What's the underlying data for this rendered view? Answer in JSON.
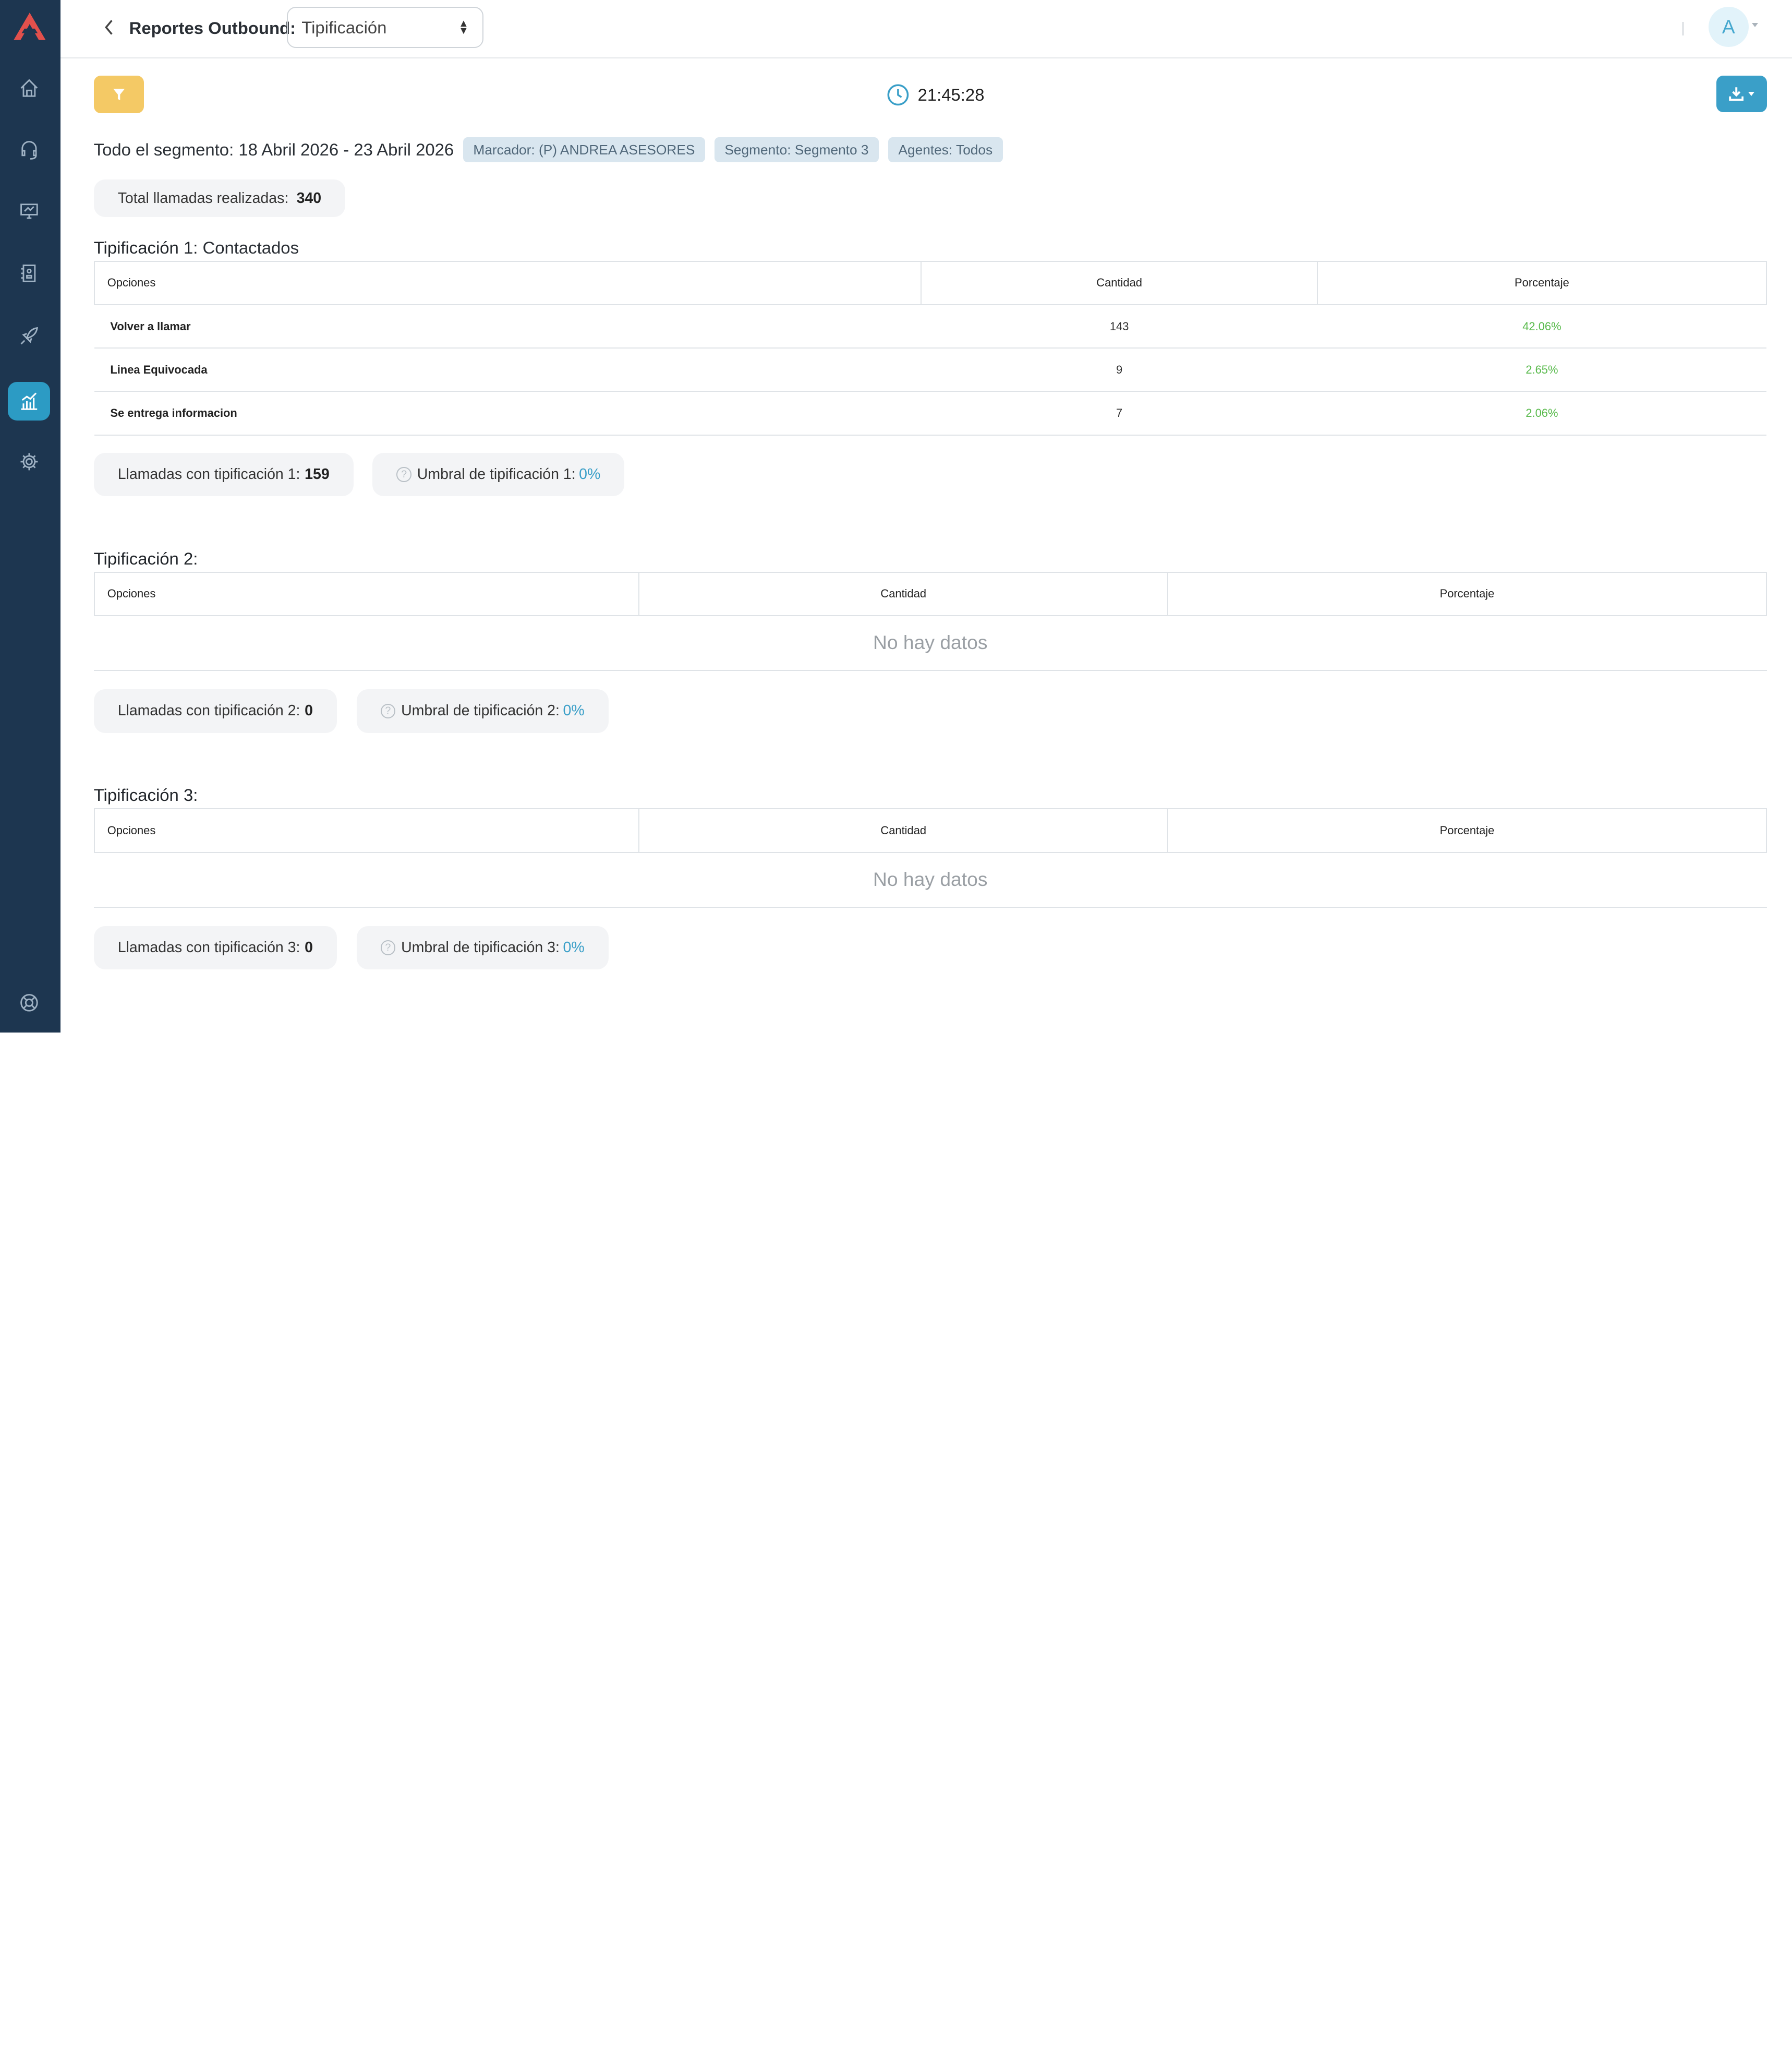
{
  "header": {
    "title": "Reportes Outbound:",
    "report_select": "Tipificación",
    "avatar_initial": "A"
  },
  "toolbar": {
    "clock_time": "21:45:28"
  },
  "segment": {
    "summary": "Todo el segmento: 18 Abril 2026 - 23 Abril 2026",
    "chips": [
      "Marcador: (P) ANDREA ASESORES",
      "Segmento: Segmento 3",
      "Agentes: Todos"
    ]
  },
  "totals": {
    "label": "Total llamadas realizadas:",
    "value": "340"
  },
  "sections": [
    {
      "title_lead": "Tipificación 1:",
      "title_value": "Contactados",
      "headers": [
        "Opciones",
        "Cantidad",
        "Porcentaje"
      ],
      "rows": [
        {
          "option": "Volver a llamar",
          "count": "143",
          "percent": "42.06%"
        },
        {
          "option": "Linea Equivocada",
          "count": "9",
          "percent": "2.65%"
        },
        {
          "option": "Se entrega informacion",
          "count": "7",
          "percent": "2.06%"
        }
      ],
      "calls_label": "Llamadas con tipificación 1:",
      "calls_value": "159",
      "threshold_label": "Umbral de tipificación 1:",
      "threshold_value": "0%"
    },
    {
      "title_lead": "Tipificación 2:",
      "headers": [
        "Opciones",
        "Cantidad",
        "Porcentaje"
      ],
      "empty_text": "No hay datos",
      "calls_label": "Llamadas con tipificación 2:",
      "calls_value": "0",
      "threshold_label": "Umbral de tipificación 2:",
      "threshold_value": "0%"
    },
    {
      "title_lead": "Tipificación 3:",
      "headers": [
        "Opciones",
        "Cantidad",
        "Porcentaje"
      ],
      "empty_text": "No hay datos",
      "calls_label": "Llamadas con tipificación 3:",
      "calls_value": "0",
      "threshold_label": "Umbral de tipificación 3:",
      "threshold_value": "0%"
    }
  ],
  "colors": {
    "sidebar": "#1d3650",
    "accent": "#3a9fc8",
    "filter": "#f4c965",
    "percent_green": "#57b94a",
    "logo_red": "#e2504c"
  },
  "icons": {
    "sidebar": [
      "home-icon",
      "headset-icon",
      "monitor-icon",
      "contacts-book-icon",
      "rocket-icon",
      "chart-icon",
      "gear-icon",
      "support-icon"
    ],
    "toolbar": [
      "filter-icon",
      "clock-icon",
      "download-icon"
    ]
  }
}
